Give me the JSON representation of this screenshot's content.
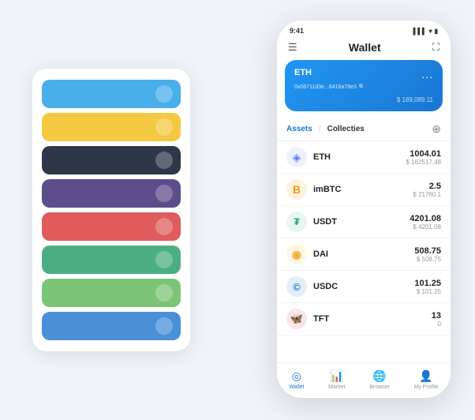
{
  "scene": {
    "background": "#f0f4f8"
  },
  "card_stack": {
    "cards": [
      {
        "id": "card-1",
        "color": "card-blue",
        "dot_text": ""
      },
      {
        "id": "card-2",
        "color": "card-yellow",
        "dot_text": ""
      },
      {
        "id": "card-3",
        "color": "card-dark",
        "dot_text": ""
      },
      {
        "id": "card-4",
        "color": "card-purple",
        "dot_text": ""
      },
      {
        "id": "card-5",
        "color": "card-red",
        "dot_text": ""
      },
      {
        "id": "card-6",
        "color": "card-green",
        "dot_text": ""
      },
      {
        "id": "card-7",
        "color": "card-lightgreen",
        "dot_text": ""
      },
      {
        "id": "card-8",
        "color": "card-blue2",
        "dot_text": ""
      }
    ]
  },
  "phone": {
    "status_bar": {
      "time": "9:41",
      "signal": "▌▌▌",
      "wifi": "▾",
      "battery": "▮"
    },
    "header": {
      "menu_icon": "☰",
      "title": "Wallet",
      "expand_icon": "⛶"
    },
    "eth_card": {
      "label": "ETH",
      "dots": "...",
      "address": "0x08711d3e...8416a78e3",
      "copy_icon": "⧉",
      "balance_prefix": "$",
      "balance": "189,089.11"
    },
    "assets": {
      "tab_assets": "Assets",
      "tab_divider": "/",
      "tab_collecties": "Collecties",
      "add_icon": "⊕"
    },
    "tokens": [
      {
        "name": "ETH",
        "icon": "◈",
        "icon_color": "#627EEA",
        "icon_bg": "#EEF0FF",
        "amount": "1004.01",
        "usd": "$ 162517.48"
      },
      {
        "name": "imBTC",
        "icon": "⑧",
        "icon_color": "#F7931A",
        "icon_bg": "#FFF3E0",
        "amount": "2.5",
        "usd": "$ 21760.1"
      },
      {
        "name": "USDT",
        "icon": "₮",
        "icon_color": "#26A17B",
        "icon_bg": "#E8F5F1",
        "amount": "4201.08",
        "usd": "$ 4201.08"
      },
      {
        "name": "DAI",
        "icon": "◉",
        "icon_color": "#F5AC37",
        "icon_bg": "#FFF8E1",
        "amount": "508.75",
        "usd": "$ 508.75"
      },
      {
        "name": "USDC",
        "icon": "©",
        "icon_color": "#2775CA",
        "icon_bg": "#E3EEFB",
        "amount": "101.25",
        "usd": "$ 101.25"
      },
      {
        "name": "TFT",
        "icon": "🦋",
        "icon_color": "#E91E63",
        "icon_bg": "#FCE4EC",
        "amount": "13",
        "usd": "0"
      }
    ],
    "bottom_nav": [
      {
        "id": "wallet",
        "icon": "◎",
        "label": "Wallet",
        "active": true
      },
      {
        "id": "market",
        "icon": "📈",
        "label": "Market",
        "active": false
      },
      {
        "id": "browser",
        "icon": "👤",
        "label": "Browser",
        "active": false
      },
      {
        "id": "profile",
        "icon": "👤",
        "label": "My Profile",
        "active": false
      }
    ]
  }
}
